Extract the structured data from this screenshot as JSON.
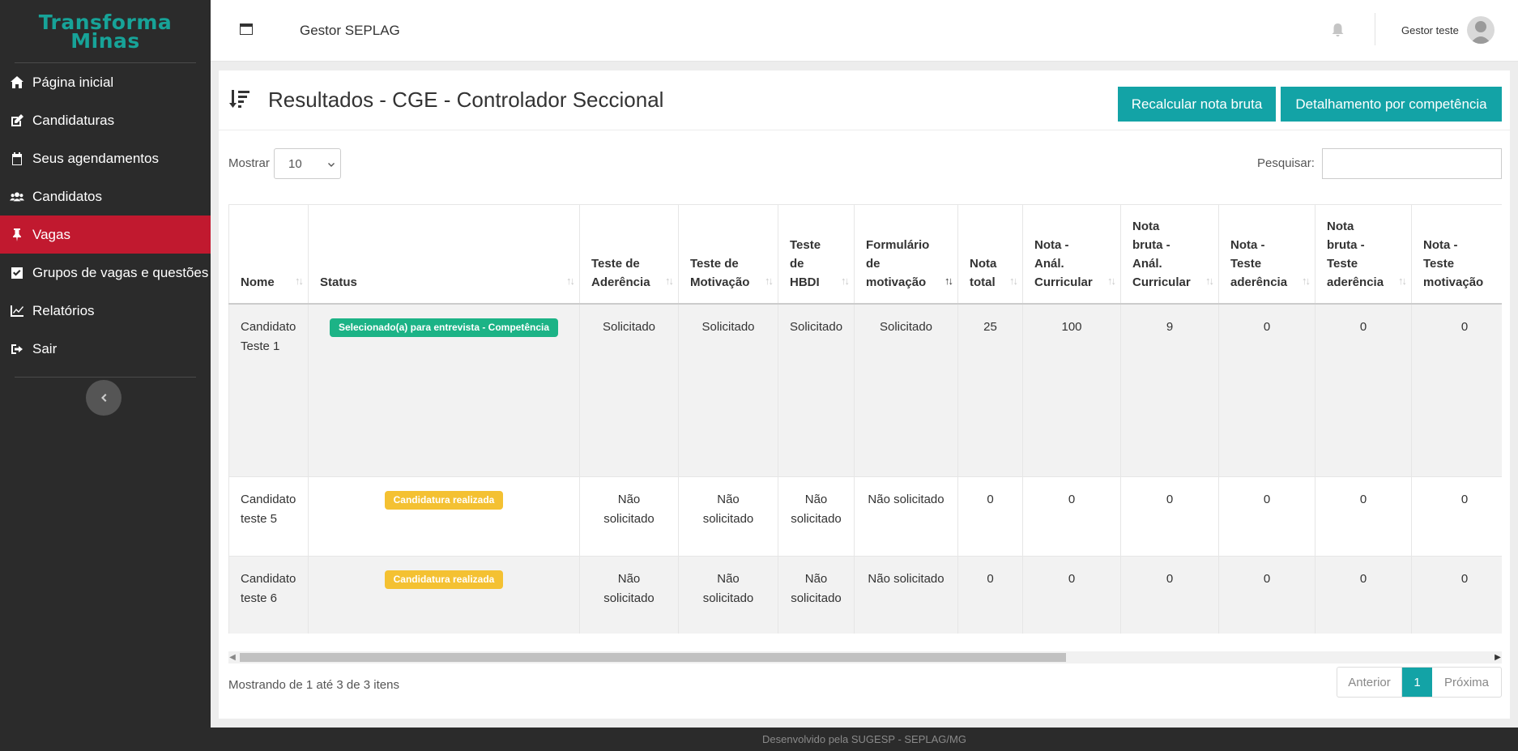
{
  "brand": {
    "line1": "Transforma",
    "line2": "Minas"
  },
  "sidebar": {
    "items": [
      {
        "label": "Página inicial",
        "icon": "home-icon"
      },
      {
        "label": "Candidaturas",
        "icon": "edit-icon"
      },
      {
        "label": "Seus agendamentos",
        "icon": "calendar-icon"
      },
      {
        "label": "Candidatos",
        "icon": "users-icon"
      },
      {
        "label": "Vagas",
        "icon": "pin-icon",
        "active": true
      },
      {
        "label": "Grupos de vagas e questões",
        "icon": "checkbox-icon"
      },
      {
        "label": "Relatórios",
        "icon": "chart-icon"
      },
      {
        "label": "Sair",
        "icon": "sign-out-icon"
      }
    ]
  },
  "header": {
    "title": "Gestor SEPLAG",
    "user": "Gestor teste"
  },
  "main": {
    "title": "Resultados - CGE - Controlador Seccional",
    "btn_recalc": "Recalcular nota bruta",
    "btn_detalhamento": "Detalhamento por competência",
    "show_label": "Mostrar",
    "show_value": "10",
    "search_label": "Pesquisar:",
    "info": "Mostrando de 1 até 3 de 3 itens",
    "pager": {
      "prev": "Anterior",
      "current": "1",
      "next": "Próxima"
    }
  },
  "table": {
    "headers": [
      [
        "Nome"
      ],
      [
        "Status"
      ],
      [
        "Teste de",
        "Aderência"
      ],
      [
        "Teste de",
        "Motivação"
      ],
      [
        "Teste",
        "de",
        "HBDI"
      ],
      [
        "Formulário",
        "de",
        "motivação"
      ],
      [
        "Nota",
        "total"
      ],
      [
        "Nota -",
        "Anál.",
        "Curricular"
      ],
      [
        "Nota",
        "bruta -",
        "Anál.",
        "Curricular"
      ],
      [
        "Nota -",
        "Teste",
        "aderência"
      ],
      [
        "Nota",
        "bruta -",
        "Teste",
        "aderência"
      ],
      [
        "Nota -",
        "Teste",
        "motivação"
      ]
    ],
    "rows": [
      {
        "nome": [
          "Candidato",
          "Teste 1"
        ],
        "status": "Selecionado(a) para entrevista - Competência",
        "status_color": "#1cb386",
        "aderencia": [
          "Solicitado"
        ],
        "motivacao": [
          "Solicitado"
        ],
        "hbdi": [
          "Solicitado"
        ],
        "formulario": [
          "Solicitado"
        ],
        "nota_total": "25",
        "nota_anal": "100",
        "bruta_anal": "9",
        "nota_ader": "0",
        "bruta_ader": "0",
        "nota_motiv": "0"
      },
      {
        "nome": [
          "Candidato",
          "teste 5"
        ],
        "status": "Candidatura realizada",
        "status_color": "#f4c132",
        "aderencia": [
          "Não",
          "solicitado"
        ],
        "motivacao": [
          "Não",
          "solicitado"
        ],
        "hbdi": [
          "Não",
          "solicitado"
        ],
        "formulario": [
          "Não solicitado"
        ],
        "nota_total": "0",
        "nota_anal": "0",
        "bruta_anal": "0",
        "nota_ader": "0",
        "bruta_ader": "0",
        "nota_motiv": "0"
      },
      {
        "nome": [
          "Candidato",
          "teste 6"
        ],
        "status": "Candidatura realizada",
        "status_color": "#f4c132",
        "aderencia": [
          "Não",
          "solicitado"
        ],
        "motivacao": [
          "Não",
          "solicitado"
        ],
        "hbdi": [
          "Não",
          "solicitado"
        ],
        "formulario": [
          "Não solicitado"
        ],
        "nota_total": "0",
        "nota_anal": "0",
        "bruta_anal": "0",
        "nota_ader": "0",
        "bruta_ader": "0",
        "nota_motiv": "0"
      }
    ]
  },
  "footer": "Desenvolvido pela SUGESP - SEPLAG/MG"
}
